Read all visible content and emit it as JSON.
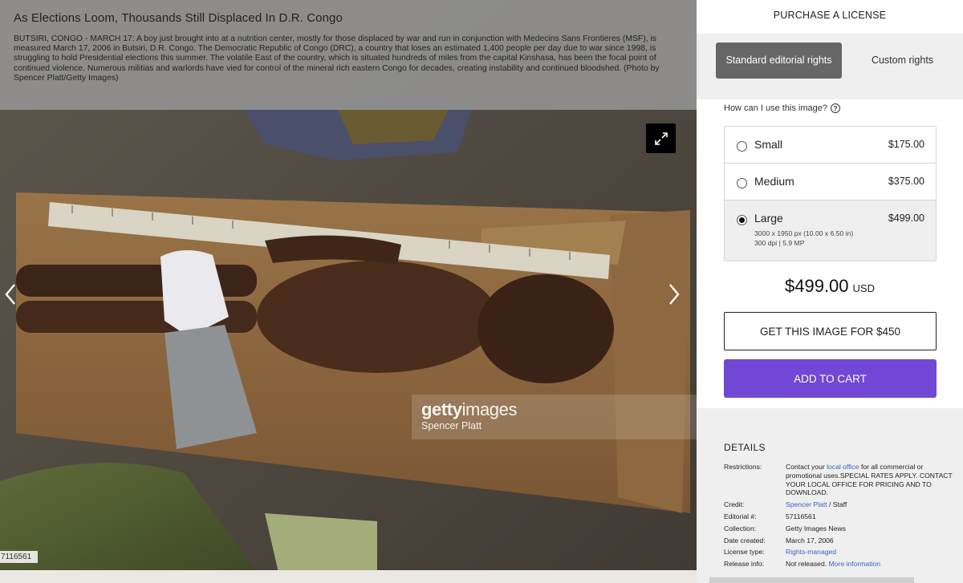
{
  "photo": {
    "title": "As Elections Loom, Thousands Still Displaced In D.R. Congo",
    "caption": "BUTSIRI, CONGO - MARCH 17: A boy just brought into at a nutrition center, mostly for those displaced by war and run in conjunction with Medecins Sans Frontieres (MSF), is measured March 17, 2006 in Butsiri, D.R. Congo. The Democratic Republic of Congo (DRC), a country that loses an estimated 1,400 people per day due to war since 1998, is struggling to hold Presidential elections this summer. The volatile East of the country, which is situated hundreds of miles from the capital Kinshasa, has been the focal point of continued violence. Numerous militias and warlords have vied for control of the mineral rich eastern Congo for decades, creating instability and continued bloodshed. (Photo by Spencer Platt/Getty Images)",
    "watermark_brand_bold": "getty",
    "watermark_brand_light": "images",
    "watermark_credit": "Spencer Platt",
    "asset_id": "7116561",
    "icons": {
      "expand": "expand-icon",
      "prev": "chevron-left-icon",
      "next": "chevron-right-icon"
    }
  },
  "panel": {
    "header": "PURCHASE A LICENSE",
    "rights": {
      "standard": "Standard editorial rights",
      "custom": "Custom rights"
    },
    "usage_question": "How can I use this image?",
    "help_icon": "?",
    "sizes": [
      {
        "name": "Small",
        "price": "$175.00",
        "selected": false
      },
      {
        "name": "Medium",
        "price": "$375.00",
        "selected": false
      },
      {
        "name": "Large",
        "price": "$499.00",
        "selected": true,
        "dims": "3000 x 1950 px (10.00 x 6.50 in)",
        "dpi": "300 dpi | 5.9 MP"
      }
    ],
    "total_amount": "$499.00",
    "total_currency": "USD",
    "get_image_button": "GET THIS IMAGE FOR $450",
    "add_to_cart_button": "ADD TO CART",
    "details": {
      "title": "DETAILS",
      "restrictions_label": "Restrictions:",
      "restrictions_pre": "Contact your ",
      "restrictions_link": "local office",
      "restrictions_post": " for all commercial or promotional uses.SPECIAL RATES APPLY. CONTACT YOUR LOCAL OFFICE FOR PRICING AND TO DOWNLOAD.",
      "credit_label": "Credit:",
      "credit_link": "Spencer Platt",
      "credit_post": " / Staff",
      "editorial_label": "Editorial #:",
      "editorial_value": "57116561",
      "collection_label": "Collection:",
      "collection_value": "Getty Images News",
      "date_label": "Date created:",
      "date_value": "March 17, 2006",
      "license_label": "License type:",
      "license_value": "Rights-managed",
      "release_label": "Release info:",
      "release_value": "Not released.",
      "release_link": "More information"
    }
  }
}
